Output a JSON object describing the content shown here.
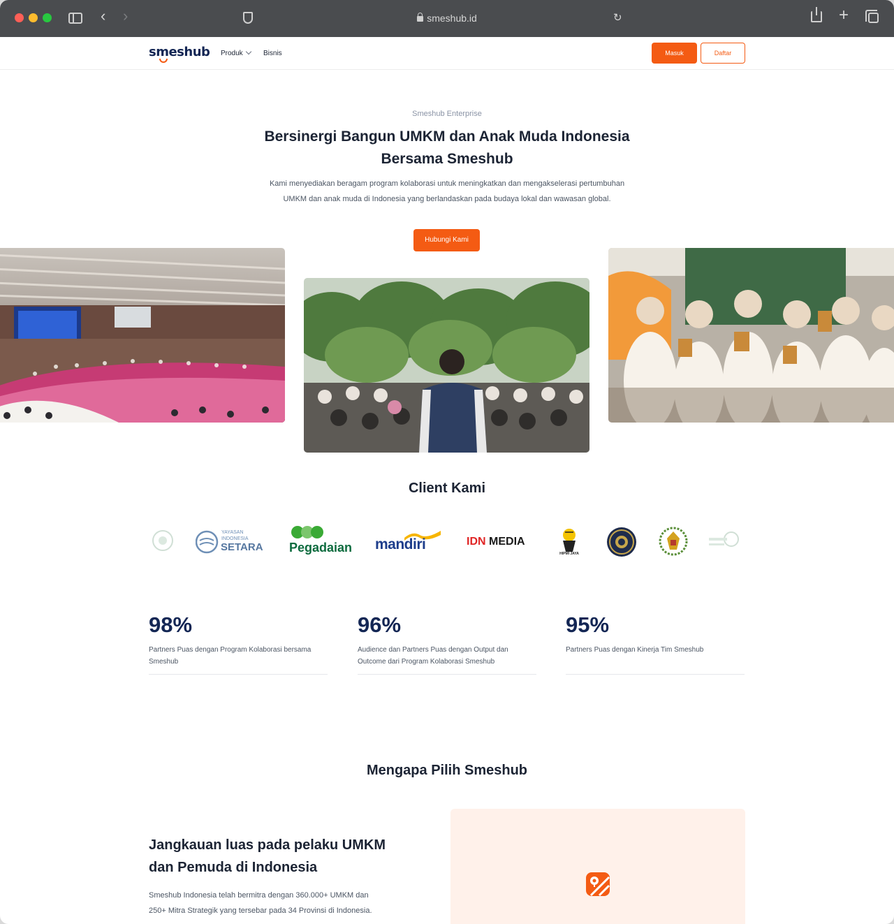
{
  "browser": {
    "url": "smeshub.id"
  },
  "nav": {
    "logo": "smeshub",
    "produk": "Produk",
    "bisnis": "Bisnis",
    "masuk": "Masuk",
    "daftar": "Daftar"
  },
  "hero": {
    "eyebrow": "Smeshub Enterprise",
    "title": "Bersinergi Bangun UMKM dan Anak Muda Indonesia Bersama Smeshub",
    "description": "Kami menyediakan beragam program kolaborasi untuk meningkatkan dan mengakselerasi pertumbuhan UMKM dan anak muda di Indonesia yang berlandaskan pada budaya lokal dan wawasan global.",
    "cta": "Hubungi Kami"
  },
  "clients": {
    "title": "Client Kami",
    "logos": {
      "setara_small": "YAYASAN",
      "setara_mid": "INDONESIA",
      "setara": "SETARA",
      "pegadaian": "Pegadaian",
      "mandiri": "mandiri",
      "idn": "IDN",
      "media": "MEDIA",
      "hipmi": "HIPMI JAYA"
    }
  },
  "stats": [
    {
      "value": "98%",
      "label": "Partners Puas dengan Program Kolaborasi bersama Smeshub"
    },
    {
      "value": "96%",
      "label": "Audience dan Partners Puas dengan Output dan Outcome dari Program Kolaborasi Smeshub"
    },
    {
      "value": "95%",
      "label": "Partners Puas dengan Kinerja Tim Smeshub"
    }
  ],
  "why": {
    "title": "Mengapa Pilih Smeshub",
    "feature_title": "Jangkauan luas pada pelaku UMKM dan Pemuda di Indonesia",
    "feature_desc": "Smeshub Indonesia telah bermitra dengan 360.000+ UMKM dan 250+ Mitra Strategik yang tersebar pada 34 Provinsi di Indonesia."
  },
  "colors": {
    "brand_orange": "#f45b13",
    "brand_navy": "#132654",
    "panel_bg": "#fff1ea"
  }
}
